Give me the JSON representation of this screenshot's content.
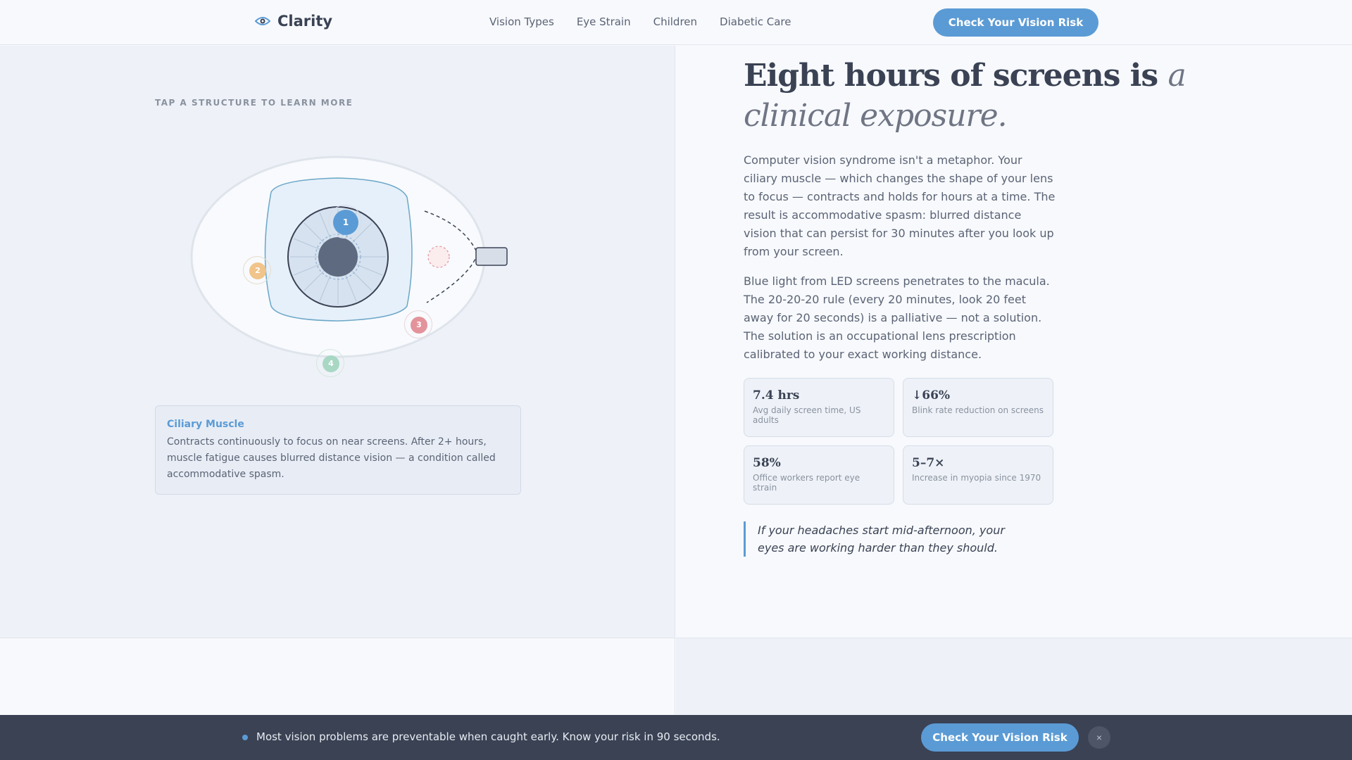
{
  "header": {
    "brand": "Clarity",
    "nav": [
      "Vision Types",
      "Eye Strain",
      "Children",
      "Diabetic Care"
    ],
    "cta": "Check Your Vision Risk"
  },
  "left": {
    "hint": "TAP A STRUCTURE TO LEARN MORE",
    "markers": [
      "1",
      "2",
      "3",
      "4"
    ],
    "colors": {
      "marker1": "#5b9bd5",
      "marker2": "#f0c48a",
      "marker3": "#e3939b",
      "marker4": "#a8d8c4"
    },
    "card": {
      "title": "Ciliary Muscle",
      "body": "Contracts continuously to focus on near screens. After 2+ hours, muscle fatigue causes blurred distance vision — a condition called accommodative spasm."
    }
  },
  "right": {
    "headline_main": "Eight hours of screens is ",
    "headline_em": "a clinical exposure.",
    "para1": "Computer vision syndrome isn't a metaphor. Your ciliary muscle — which changes the shape of your lens to focus — contracts and holds for hours at a time. The result is accommodative spasm: blurred distance vision that can persist for 30 minutes after you look up from your screen.",
    "para2": "Blue light from LED screens penetrates to the macula. The 20-20-20 rule (every 20 minutes, look 20 feet away for 20 seconds) is a palliative — not a solution. The solution is an occupational lens prescription calibrated to your exact working distance.",
    "stats": [
      {
        "value": "7.4 hrs",
        "label": "Avg daily screen time, US adults"
      },
      {
        "value": "↓66%",
        "label": "Blink rate reduction on screens"
      },
      {
        "value": "58%",
        "label": "Office workers report eye strain"
      },
      {
        "value": "5–7×",
        "label": "Increase in myopia since 1970"
      }
    ],
    "quote": "If your headaches start mid-afternoon, your eyes are working harder than they should."
  },
  "bottom_bar": {
    "text": "Most vision problems are preventable when caught early. Know your risk in 90 seconds.",
    "cta": "Check Your Vision Risk",
    "close": "×"
  },
  "theme": {
    "accent": "#5b9bd5",
    "dark": "#3a4254"
  }
}
